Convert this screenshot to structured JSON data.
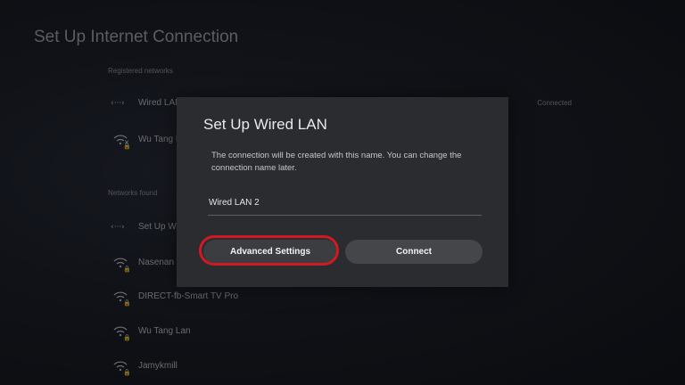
{
  "page": {
    "title": "Set Up Internet Connection"
  },
  "registered": {
    "heading": "Registered networks",
    "items": [
      {
        "label": "Wired LAN",
        "status": "Connected",
        "icon": "wired-lan-icon"
      },
      {
        "label": "Wu Tang L",
        "status": "",
        "icon": "wifi-disconnected-locked-icon"
      }
    ]
  },
  "found": {
    "heading": "Networks found",
    "items": [
      {
        "label": "Set Up Wi",
        "icon": "wired-lan-icon"
      },
      {
        "label": "Nasenan",
        "icon": "wifi-locked-icon"
      },
      {
        "label": "DIRECT-fb-Smart TV Pro",
        "icon": "wifi-locked-icon"
      },
      {
        "label": "Wu Tang Lan",
        "icon": "wifi-locked-icon"
      },
      {
        "label": "Jamykmill",
        "icon": "wifi-locked-icon"
      }
    ]
  },
  "dialog": {
    "title": "Set Up Wired LAN",
    "description": "The connection will be created with this name. You can change the connection name later.",
    "name_value": "Wired LAN 2",
    "advanced_label": "Advanced Settings",
    "connect_label": "Connect",
    "highlight_color": "#d01a22"
  }
}
